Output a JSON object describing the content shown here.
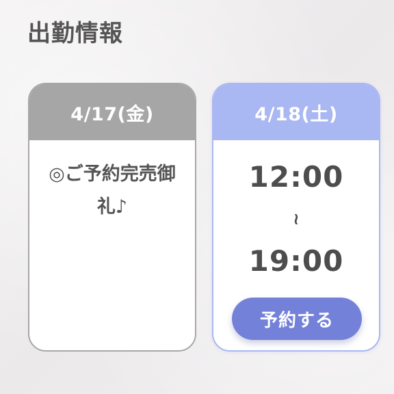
{
  "section": {
    "title": "出勤情報"
  },
  "schedule": [
    {
      "date": "4/17(金)",
      "note": "◎ご予約完売御礼♪"
    },
    {
      "date": "4/18(土)",
      "start_time": "12:00",
      "separator": "≀",
      "end_time": "19:00",
      "button_label": "予約する"
    }
  ],
  "colors": {
    "gray_header": "#a6a6a6",
    "blue_header": "#a9b7f2",
    "button": "#7481d9",
    "text": "#555555"
  }
}
